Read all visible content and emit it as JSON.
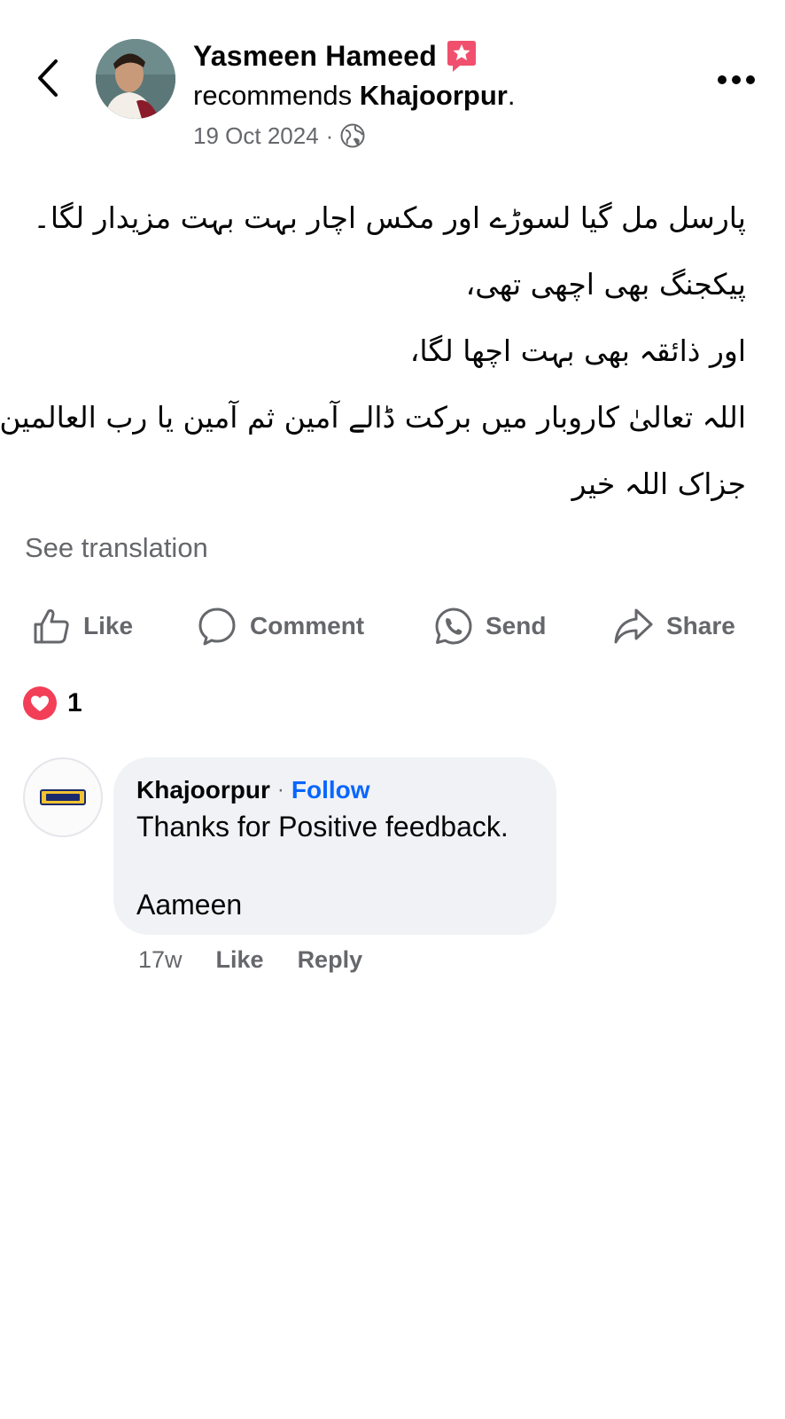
{
  "post": {
    "author": "Yasmeen Hameed",
    "recommends_prefix": "recommends ",
    "page_name": "Khajoorpur",
    "recommends_suffix": ".",
    "date": "19 Oct 2024",
    "date_separator": "·",
    "privacy_icon": "globe-icon",
    "badge_icon": "recommendation-star-icon",
    "body_lines": [
      "پارسل مل گیا لسوڑے اور مکس اچار بہت بہت مزیدار لگا۔",
      "پیکجنگ بھی اچھی تھی،",
      "اور ذائقہ بھی بہت اچھا لگا،",
      "اللہ تعالیٰ کاروبار میں برکت ڈالے آمین ثم آمین یا رب العالمین",
      "جزاک اللہ خیر"
    ],
    "see_translation": "See translation"
  },
  "actions": {
    "like": "Like",
    "comment": "Comment",
    "send": "Send",
    "share": "Share"
  },
  "reactions": {
    "icon": "heart-reaction-icon",
    "count": "1"
  },
  "comment": {
    "author": "Khajoorpur",
    "separator": "·",
    "follow": "Follow",
    "text": "Thanks for Positive feedback.\n\nAameen",
    "time": "17w",
    "like": "Like",
    "reply": "Reply"
  },
  "colors": {
    "link_blue": "#0866ff",
    "secondary_text": "#65676b",
    "heart_red": "#f33e58",
    "bubble_bg": "#f0f2f5",
    "badge_pink": "#f0506e"
  }
}
